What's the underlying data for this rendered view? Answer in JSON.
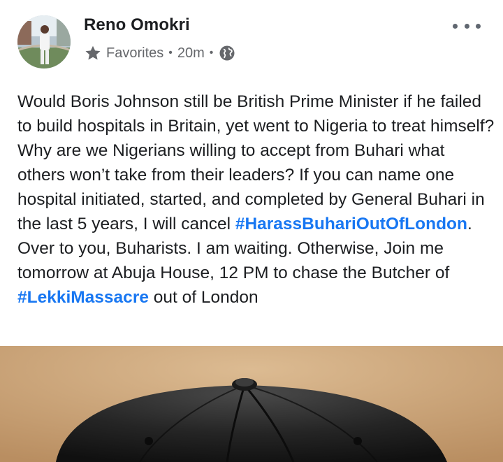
{
  "post": {
    "author": "Reno Omokri",
    "audience": "Favorites",
    "time": "20m",
    "body_part1": "Would Boris Johnson still be British Prime Minister if he failed to build hospitals in Britain, yet went to Nigeria to treat himself? Why are we Nigerians willing to accept from Buhari what others won’t take from their leaders? If you can name one hospital initiated, started, and completed by General Buhari in the last 5 years, I will cancel ",
    "hashtag1": "#HarassBuhariOutOfLondon",
    "body_part2": ". Over to you, Buharists. I am waiting. Otherwise, Join me tomorrow at Abuja House, 12 PM to chase the Butcher of ",
    "hashtag2": "#LekkiMassacre",
    "body_part3": " out of London"
  },
  "icons": {
    "avatar": "profile-photo",
    "audience": "star-icon",
    "privacy": "globe-icon",
    "more": "more-options-icon"
  },
  "colors": {
    "hashtag": "#1877f2",
    "meta": "#65676b",
    "text": "#1c1e21"
  }
}
